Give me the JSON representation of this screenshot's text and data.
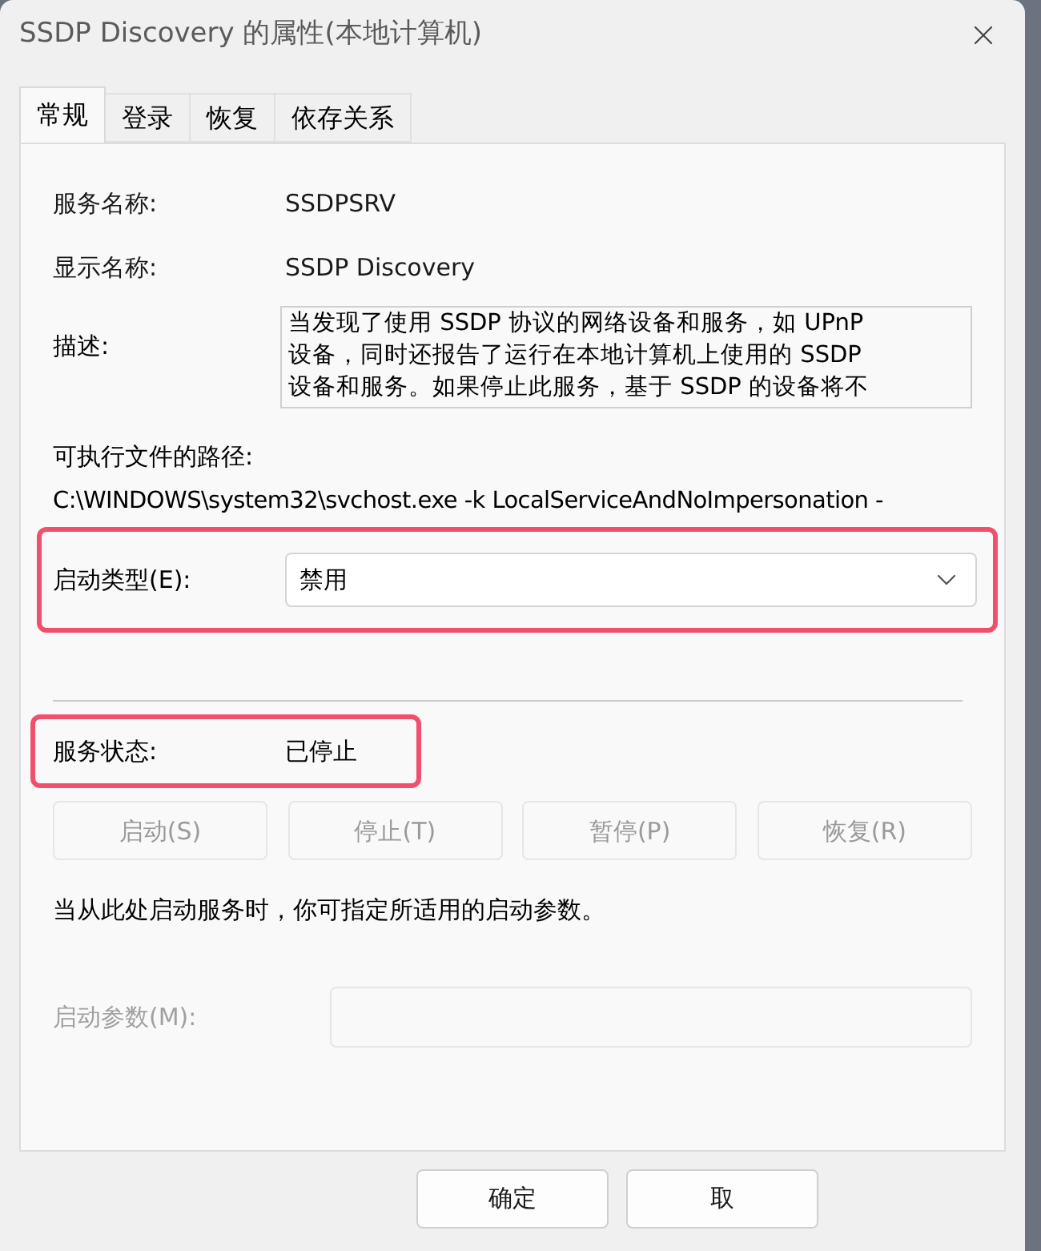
{
  "window": {
    "title": "SSDP Discovery 的属性(本地计算机)"
  },
  "tabs": [
    {
      "label": "常规",
      "selected": true
    },
    {
      "label": "登录",
      "selected": false
    },
    {
      "label": "恢复",
      "selected": false
    },
    {
      "label": "依存关系",
      "selected": false
    }
  ],
  "service_name": {
    "label": "服务名称:",
    "value": "SSDPSRV"
  },
  "display_name": {
    "label": "显示名称:",
    "value": "SSDP Discovery"
  },
  "description": {
    "label": "描述:",
    "lines": [
      "当发现了使用 SSDP 协议的网络设备和服务，如 UPnP",
      "设备，同时还报告了运行在本地计算机上使用的 SSDP",
      "设备和服务。如果停止此服务，基于 SSDP 的设备将不"
    ]
  },
  "path": {
    "label": "可执行文件的路径:",
    "value": "C:\\WINDOWS\\system32\\svchost.exe -k LocalServiceAndNoImpersonation -"
  },
  "startup_type": {
    "label": "启动类型(E):",
    "value": "禁用",
    "highlighted": true
  },
  "service_status": {
    "label": "服务状态:",
    "value": "已停止",
    "highlighted": true
  },
  "service_buttons": [
    {
      "label": "启动(S)",
      "disabled": true
    },
    {
      "label": "停止(T)",
      "disabled": true
    },
    {
      "label": "暂停(P)",
      "disabled": true
    },
    {
      "label": "恢复(R)",
      "disabled": true
    }
  ],
  "hint": "当从此处启动服务时，你可指定所适用的启动参数。",
  "start_params": {
    "label": "启动参数(M):",
    "disabled": true
  },
  "buttons": [
    {
      "label": "确定"
    },
    {
      "label": "取"
    }
  ]
}
